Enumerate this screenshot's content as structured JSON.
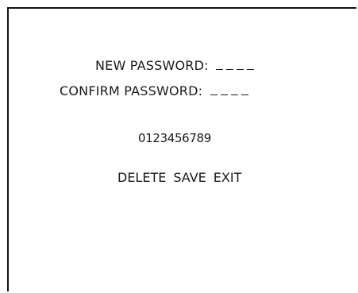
{
  "form": {
    "new_password_label": "NEW PASSWORD:",
    "new_password_slots": 4,
    "confirm_password_label": "CONFIRM PASSWORD:",
    "confirm_password_slots": 4
  },
  "keypad": {
    "digits": [
      "0",
      "1",
      "2",
      "3",
      "4",
      "5",
      "6",
      "7",
      "8",
      "9"
    ]
  },
  "actions": {
    "delete_label": "DELETE",
    "save_label": "SAVE",
    "exit_label": "EXIT"
  }
}
